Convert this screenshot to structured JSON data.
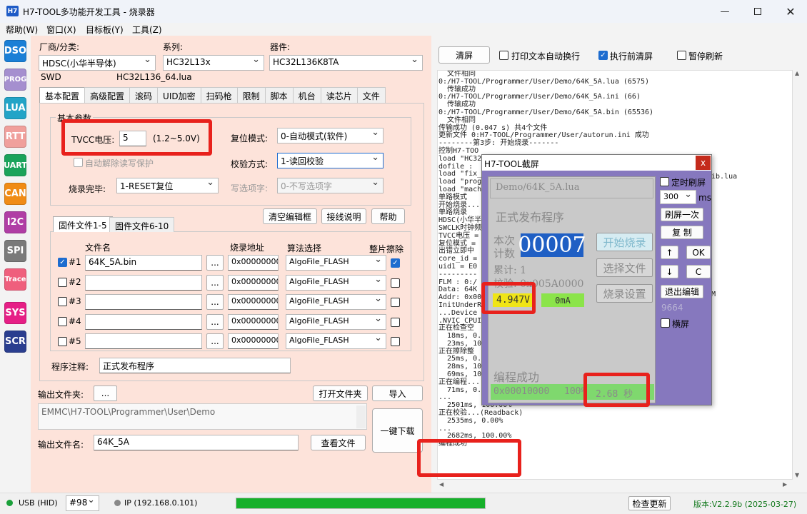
{
  "window": {
    "title": "H7-TOOL多功能开发工具 - 烧录器",
    "icon_text": "H7",
    "minimize_icon": "minimize-icon",
    "maximize_icon": "maximize-icon",
    "close_icon": "close-icon"
  },
  "menu": [
    "帮助(W)",
    "窗口(X)",
    "目标板(Y)",
    "工具(Z)"
  ],
  "sidebar": [
    {
      "label": "DSO",
      "color": "#1a7fd6"
    },
    {
      "label": "PROG",
      "color": "#a58fcf"
    },
    {
      "label": "LUA",
      "color": "#22a4c7"
    },
    {
      "label": "RTT",
      "color": "#f0a09c"
    },
    {
      "label": "UART",
      "color": "#19a35b"
    },
    {
      "label": "CAN",
      "color": "#f08c16"
    },
    {
      "label": "I2C",
      "color": "#b03ea5"
    },
    {
      "label": "SPI",
      "color": "#7a7a7a"
    },
    {
      "label": "Trace",
      "color": "#ef5f7d"
    },
    {
      "label": "SYS",
      "color": "#e61f86"
    },
    {
      "label": "SCR",
      "color": "#2a3e8f"
    }
  ],
  "device": {
    "vendor_label": "厂商/分类:",
    "vendor_value": "HDSC(小华半导体)",
    "series_label": "系列:",
    "series_value": "HC32L13x",
    "chip_label": "器件:",
    "chip_value": "HC32L136K8TA",
    "interface": "SWD",
    "lua_file": "HC32L136_64.lua"
  },
  "tabs": [
    "基本配置",
    "高级配置",
    "滚码",
    "UID加密",
    "扫码枪",
    "限制",
    "脚本",
    "机台",
    "读芯片",
    "文件"
  ],
  "basic": {
    "group_label": "基本参数",
    "tvcc_label": "TVCC电压:",
    "tvcc_value": "5",
    "tvcc_range": "(1.2~5.0V)",
    "auto_unlock": "自动解除读写保护",
    "reset_label": "复位模式:",
    "reset_value": "0-自动模式(软件)",
    "verify_label": "校验方式:",
    "verify_value": "1-读回校验",
    "write_opt_label": "写选项字:",
    "write_opt_value": "0-不写选项字",
    "done_label": "烧录完毕:",
    "done_value": "1-RESET复位"
  },
  "files": {
    "tab1": "固件文件1-5",
    "tab2": "固件文件6-10",
    "clear_btn": "清空编辑框",
    "wiring_btn": "接线说明",
    "help_btn": "帮助",
    "col_name": "文件名",
    "col_addr": "烧录地址",
    "col_algo": "算法选择",
    "col_erase": "整片擦除",
    "browse": "...",
    "rows": [
      {
        "idx": "#1",
        "checked": true,
        "file": "64K_5A.bin",
        "addr": "0x00000000",
        "algo": "AlgoFile_FLASH",
        "erase": true
      },
      {
        "idx": "#2",
        "checked": false,
        "file": "",
        "addr": "0x00000000",
        "algo": "AlgoFile_FLASH",
        "erase": false
      },
      {
        "idx": "#3",
        "checked": false,
        "file": "",
        "addr": "0x00000000",
        "algo": "AlgoFile_FLASH",
        "erase": false
      },
      {
        "idx": "#4",
        "checked": false,
        "file": "",
        "addr": "0x00000000",
        "algo": "AlgoFile_FLASH",
        "erase": false
      },
      {
        "idx": "#5",
        "checked": false,
        "file": "",
        "addr": "0x00000000",
        "algo": "AlgoFile_FLASH",
        "erase": false
      }
    ],
    "note_label": "程序注释:",
    "note_value": "正式发布程序"
  },
  "output": {
    "folder_label": "输出文件夹:",
    "folder_btn": "...",
    "open_folder_btn": "打开文件夹",
    "import_btn": "导入",
    "path": "EMMC\\H7-TOOL\\Programmer\\User\\Demo",
    "name_label": "输出文件名:",
    "name_value": "64K_5A",
    "view_btn": "查看文件",
    "download_btn": "一键下载"
  },
  "log_toolbar": {
    "clear_btn": "清屏",
    "autowrap": "打印文本自动换行",
    "clear_before": "执行前清屏",
    "pause": "暂停刷新"
  },
  "log_lines": [
    "  文件相同",
    "0:/H7-TOOL/Programmer/User/Demo/64K_5A.lua (6575)",
    "  传输成功",
    "0:/H7-TOOL/Programmer/User/Demo/64K_5A.ini (66)",
    "  传输成功",
    "0:/H7-TOOL/Programmer/User/Demo/64K_5A.bin (65536)",
    "  文件相同",
    "传输成功 (0.047 s) 共4个文件",
    "更新文件 0:H7-TOOL/Programmer/User/autorun.ini 成功",
    "",
    "--------第3步: 开始烧录-------",
    "控制H7-TOO",
    "load \"HC32",
    "dofile :",
    "load \"fix_",
    "load \"prog",
    "load \"mach",
    "单路模式",
    "开始烧录...",
    "单路烧录",
    "HDSC(小华半",
    "SWCLK时钟频",
    "TVCC电压 =",
    "复位模式 =",
    "出错立即中",
    "core_id =",
    "uid1 = E0",
    "---------",
    "FLM : 0:/",
    "Data: 64K",
    "Addr: 0x00",
    "InitUnderR",
    "...Device N",
    ".NVIC_CPUI",
    "正在检查空",
    "  18ms, 0.",
    "  23ms, 10",
    "正在擦除整",
    "  25ms, 0.",
    "  28ms, 10",
    "  69ms, 10",
    "正在编程...",
    "  71ms, 0.00%",
    "...",
    "  2501ms, 100.00%",
    "正在校验...(Readback)",
    "  2535ms, 0.00%",
    "...",
    "  2682ms, 100.00%",
    "编程成功"
  ],
  "log_tail_right": [
    "ib.lua",
    "M"
  ],
  "popup": {
    "title": "H7-TOOL截屏",
    "close": "x",
    "screen": {
      "file": "Demo/64K_5A.lua",
      "note": "正式发布程序",
      "count_label1": "本次",
      "count_label2": "计数",
      "count": "00007",
      "total": "累计: 1",
      "checksum": "校验: 0x005A0000",
      "voltage": "4.947V",
      "current": "0mA",
      "status": "编程成功",
      "addr": "0x00010000",
      "percent": "100%",
      "time": "2.68 秒",
      "start_btn": "开始烧录",
      "select_btn": "选择文件",
      "settings_btn": "烧录设置"
    },
    "timer_refresh": "定时刷屏",
    "interval_value": "300",
    "interval_unit": "ms",
    "refresh_once": "刷屏一次",
    "copy": "复 制",
    "up_icon": "up-arrow-icon",
    "down_icon": "down-arrow-icon",
    "up": "↑",
    "down": "↓",
    "ok": "OK",
    "c": "C",
    "exit_edit": "退出编辑",
    "code": "9664",
    "landscape": "横屏"
  },
  "status": {
    "usb": "USB (HID)",
    "port": "#98",
    "ip": "IP (192.168.0.101)",
    "progress": 1.0,
    "check_update": "检查更新",
    "version": "版本:V2.2.9b (2025-03-27)"
  }
}
